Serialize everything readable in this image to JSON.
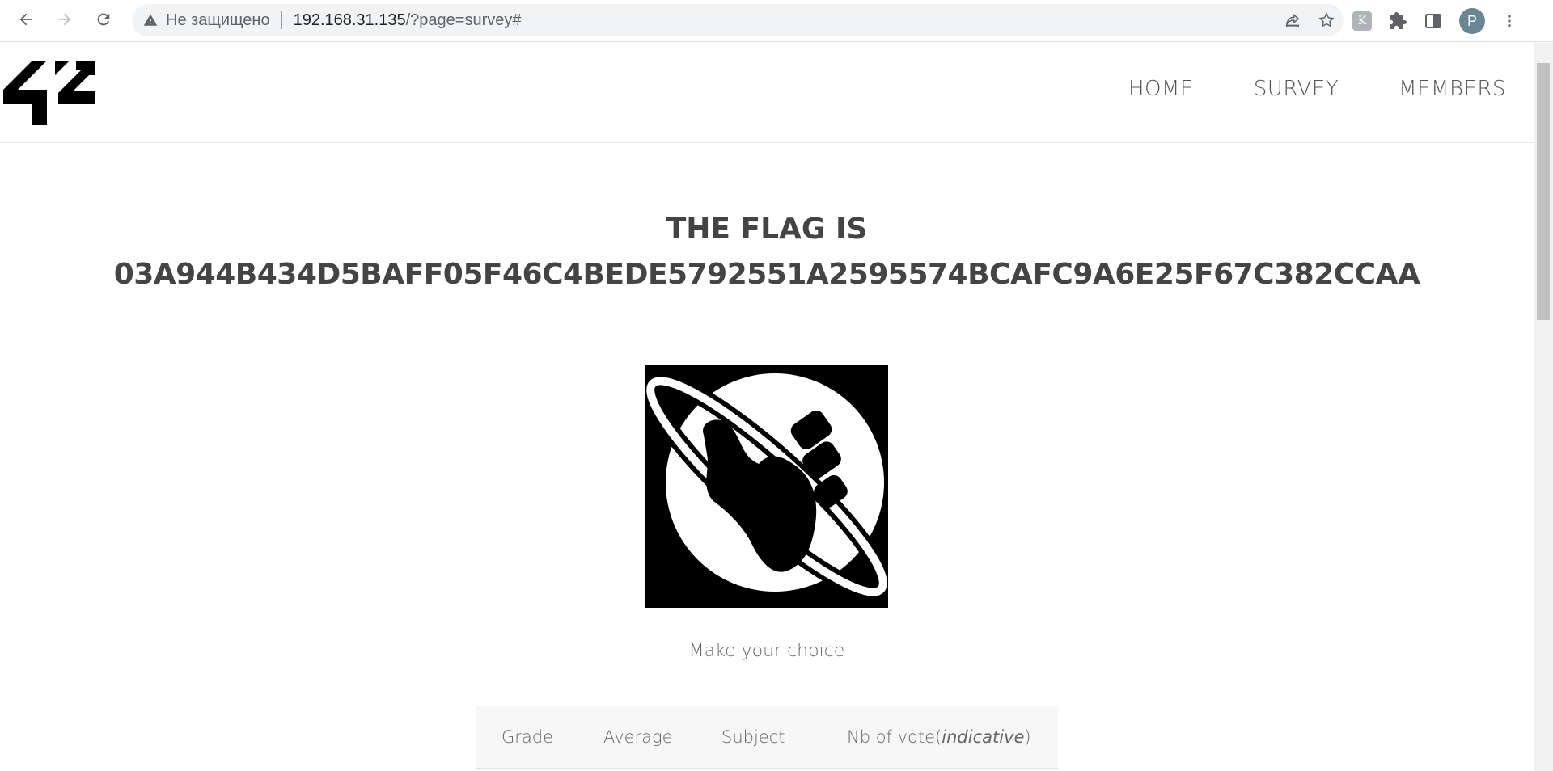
{
  "browser": {
    "security_label": "Не защищено",
    "url_host": "192.168.31.135",
    "url_path": "/?page=survey#",
    "profile_initial": "P",
    "extension_letter": "K"
  },
  "site": {
    "logo": "42",
    "nav": [
      {
        "label": "HOME"
      },
      {
        "label": "SURVEY"
      },
      {
        "label": "MEMBERS"
      }
    ]
  },
  "main": {
    "flag_label": "THE FLAG IS",
    "flag_value": "03A944B434D5BAFF05F46C4BEDE5792551A2595574BCAFC9A6E25F67C382CCAA",
    "choice_text": "Make your choice",
    "table": {
      "headers": [
        {
          "label": "Grade"
        },
        {
          "label": "Average"
        },
        {
          "label": "Subject"
        },
        {
          "label": "Nb of vote(",
          "italic": "indicative",
          "suffix": ")"
        }
      ]
    }
  }
}
